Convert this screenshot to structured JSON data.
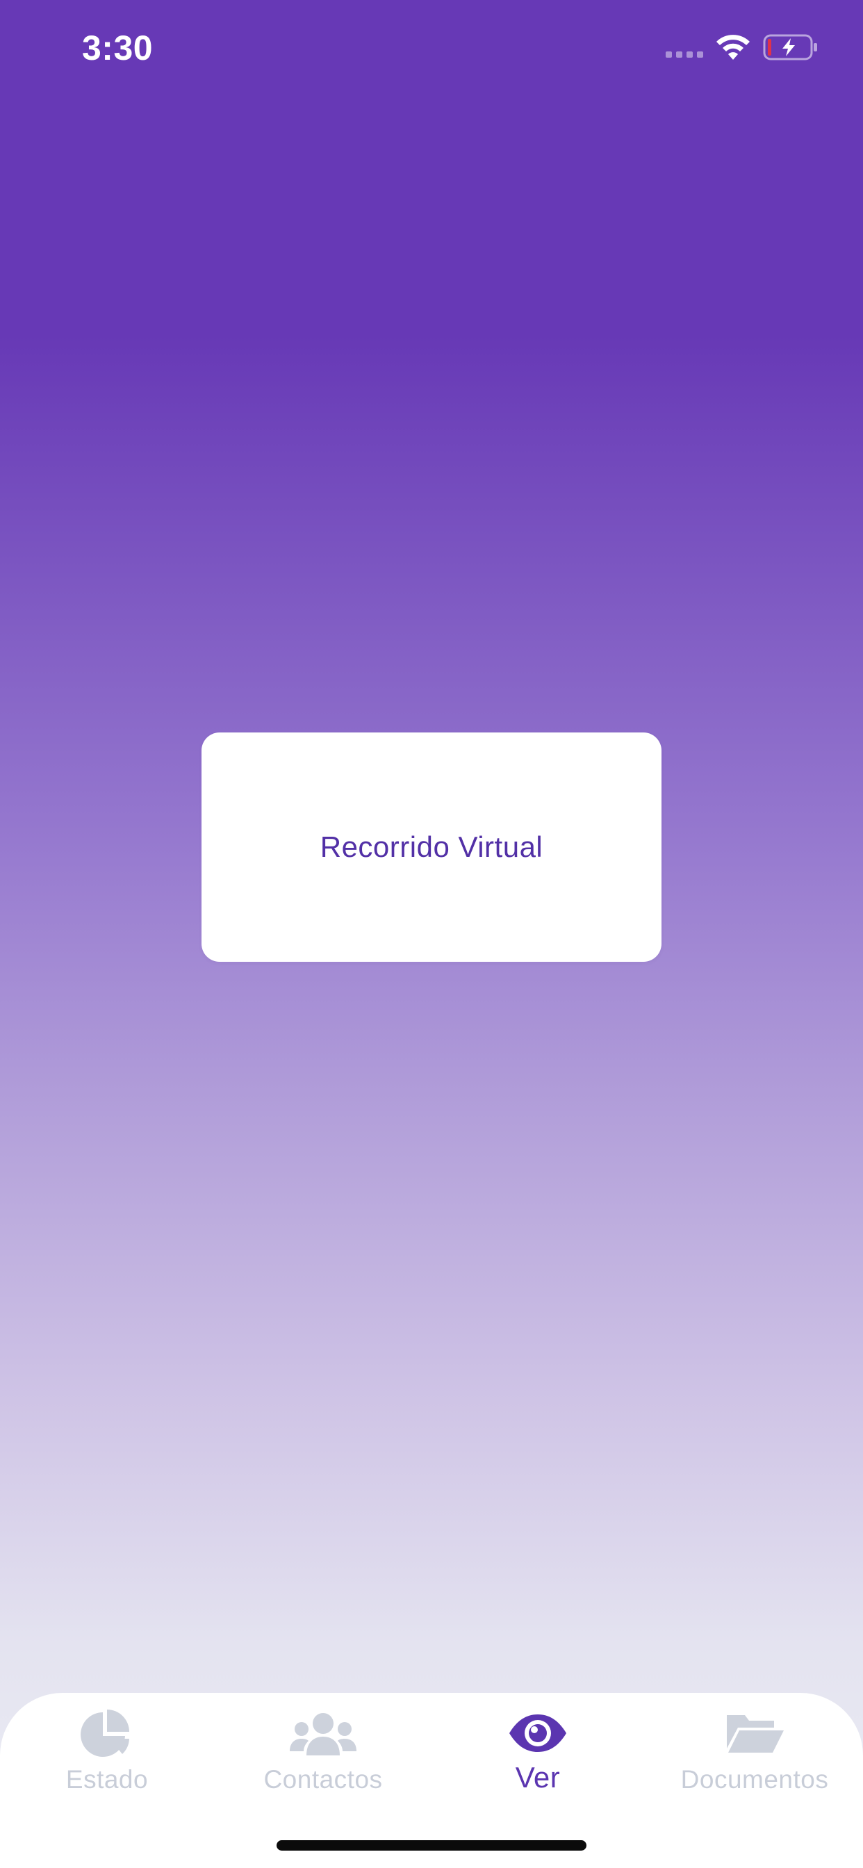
{
  "status_bar": {
    "time": "3:30",
    "icons": [
      "signal-icon",
      "wifi-icon",
      "battery-charging-icon"
    ]
  },
  "main": {
    "card_label": "Recorrido Virtual"
  },
  "tab_bar": {
    "items": [
      {
        "label": "Estado",
        "icon": "pie-chart-icon",
        "active": false
      },
      {
        "label": "Contactos",
        "icon": "users-icon",
        "active": false
      },
      {
        "label": "Ver",
        "icon": "eye-icon",
        "active": true
      },
      {
        "label": "Documentos",
        "icon": "folder-open-icon",
        "active": false
      }
    ]
  },
  "colors": {
    "brand_purple": "#6739b6",
    "active_tab": "#5b35b0",
    "inactive_tab": "#c8cdd8",
    "card_text": "#5230a6"
  }
}
